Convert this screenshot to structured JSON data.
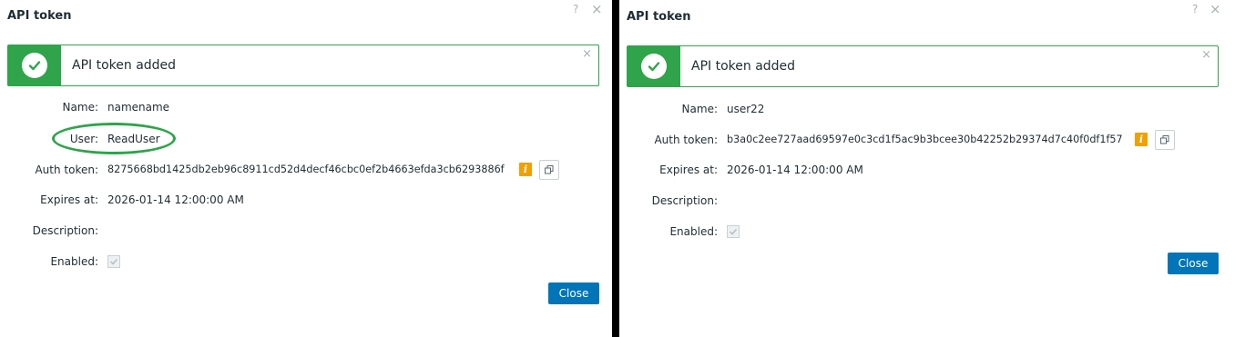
{
  "left": {
    "title": "API token",
    "help_icon": "?",
    "close_icon": "×",
    "message": {
      "text": "API token added",
      "icon": "check-icon",
      "close": "×"
    },
    "fields": {
      "name_label": "Name:",
      "name_value": "namename",
      "user_label": "User:",
      "user_value": "ReadUser",
      "auth_label": "Auth token:",
      "auth_value": "8275668bd1425db2eb96c8911cd52d4decf46cbc0ef2b4663efda3cb6293886f",
      "expires_label": "Expires at:",
      "expires_value": "2026-01-14 12:00:00 AM",
      "description_label": "Description:",
      "description_value": "",
      "enabled_label": "Enabled:",
      "enabled": true
    },
    "info_badge": "i",
    "close_button": "Close"
  },
  "right": {
    "title": "API token",
    "help_icon": "?",
    "close_icon": "×",
    "message": {
      "text": "API token added",
      "icon": "check-icon",
      "close": "×"
    },
    "fields": {
      "name_label": "Name:",
      "name_value": "user22",
      "auth_label": "Auth token:",
      "auth_value": "b3a0c2ee727aad69597e0c3cd1f5ac9b3bcee30b42252b29374d7c40f0df1f57",
      "expires_label": "Expires at:",
      "expires_value": "2026-01-14 12:00:00 AM",
      "description_label": "Description:",
      "description_value": "",
      "enabled_label": "Enabled:",
      "enabled": true
    },
    "info_badge": "i",
    "close_button": "Close"
  },
  "colors": {
    "success": "#2fa44a",
    "primary": "#0275b8",
    "info": "#f0a000",
    "highlight": "#2fa44a"
  }
}
